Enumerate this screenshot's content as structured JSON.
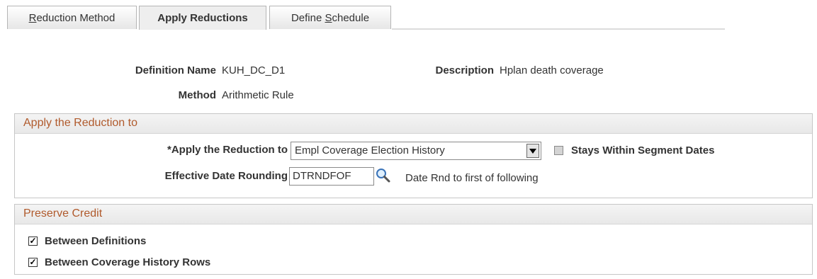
{
  "tabs": [
    {
      "pre": "",
      "u": "R",
      "post": "eduction Method"
    },
    {
      "pre": "Apply Reductions",
      "u": "",
      "post": ""
    },
    {
      "pre": "Define ",
      "u": "S",
      "post": "chedule"
    }
  ],
  "header": {
    "definition_name_label": "Definition Name",
    "definition_name_value": "KUH_DC_D1",
    "description_label": "Description",
    "description_value": "Hplan death coverage",
    "method_label": "Method",
    "method_value": "Arithmetic Rule"
  },
  "apply_section": {
    "title": "Apply the Reduction to",
    "apply_label": "*Apply the Reduction to",
    "apply_value": "Empl Coverage Election History",
    "stays_label": "Stays Within Segment Dates",
    "stays_checked": false,
    "rounding_label": "Effective Date Rounding",
    "rounding_value": "DTRNDFOF",
    "rounding_desc": "Date Rnd to first of following"
  },
  "preserve_section": {
    "title": "Preserve Credit",
    "between_definitions_label": "Between Definitions",
    "between_definitions_checked": true,
    "between_history_label": "Between Coverage History Rows",
    "between_history_checked": true
  },
  "icons": {
    "lookup": "magnifier-icon",
    "dropdown": "dropdown-arrow-icon"
  },
  "colors": {
    "section_title": "#b05a2c"
  }
}
